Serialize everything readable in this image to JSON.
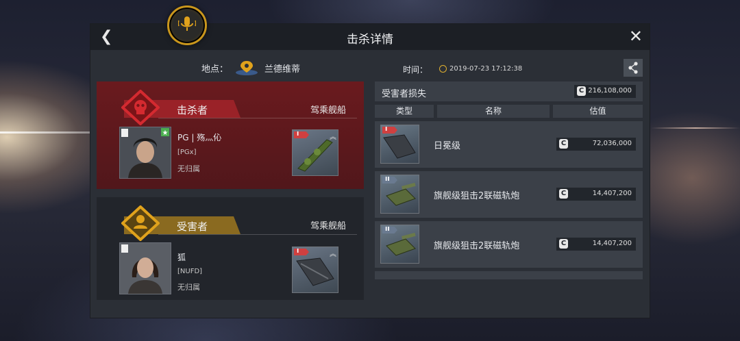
{
  "header": {
    "title": "击杀详情"
  },
  "location": {
    "label": "地点：",
    "name": "兰德维蒂"
  },
  "time": {
    "label": "时间：",
    "value": "2019-07-23 17:12:38"
  },
  "killer": {
    "role": "击杀者",
    "ship_label": "驾乘舰船",
    "name": "PG | 殇灬伈",
    "tag": "[PGx]",
    "affiliation": "无归属",
    "ship_tier": "I"
  },
  "victim": {
    "role": "受害者",
    "ship_label": "驾乘舰船",
    "name": "狐",
    "tag": "[NUFD]",
    "affiliation": "无归属",
    "ship_tier": "I"
  },
  "loss": {
    "title": "受害者损失",
    "total": "216,108,000",
    "currency_symbol": "C",
    "columns": [
      "类型",
      "名称",
      "估值"
    ],
    "items": [
      {
        "tier": "I",
        "name": "日冕级",
        "value": "72,036,000"
      },
      {
        "tier": "II",
        "name": "旗舰级狙击2联磁轨炮",
        "value": "14,407,200"
      },
      {
        "tier": "II",
        "name": "旗舰级狙击2联磁轨炮",
        "value": "14,407,200"
      }
    ]
  },
  "colors": {
    "killer_red": "#d42a30",
    "victim_gold": "#e0a21c",
    "accent_gold": "#c9961c"
  }
}
